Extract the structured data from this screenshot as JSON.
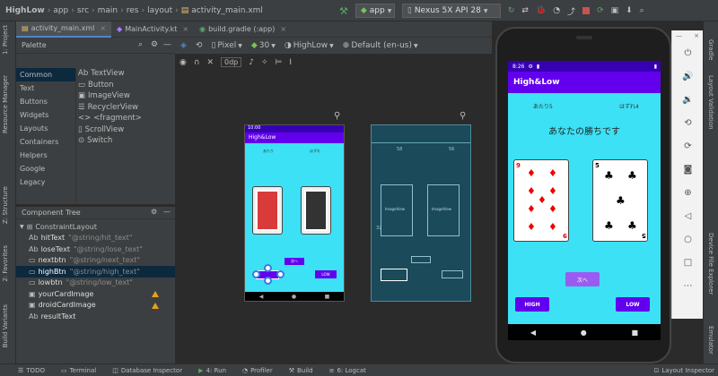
{
  "nav": {
    "crumbs": [
      "HighLow",
      "app",
      "src",
      "main",
      "res",
      "layout",
      "activity_main.xml"
    ],
    "run_config": "app",
    "device": "Nexus 5X API 28"
  },
  "tabs": [
    {
      "label": "activity_main.xml"
    },
    {
      "label": "MainActivity.kt"
    },
    {
      "label": "build.gradle (:app)"
    }
  ],
  "left_strip": [
    "1: Project",
    "Resource Manager",
    "Z: Structure",
    "2: Favorites",
    "Build Variants"
  ],
  "right_strip": [
    "Gradle",
    "Layout Validation",
    "Device File Explorer",
    "Emulator"
  ],
  "palette": {
    "title": "Palette",
    "categories": [
      "Common",
      "Text",
      "Buttons",
      "Widgets",
      "Layouts",
      "Containers",
      "Helpers",
      "Google",
      "Legacy"
    ],
    "items": [
      "TextView",
      "Button",
      "ImageView",
      "RecyclerView",
      "<fragment>",
      "ScrollView",
      "Switch"
    ],
    "item_icons": [
      "Ab",
      "▭",
      "▣",
      "☰",
      "<>",
      "▯",
      "⊙"
    ]
  },
  "tree": {
    "title": "Component Tree",
    "root": "ConstraintLayout",
    "rows": [
      {
        "icon": "Ab",
        "name": "hitText",
        "attr": "\"@string/hit_text\""
      },
      {
        "icon": "Ab",
        "name": "loseText",
        "attr": "\"@string/lose_text\""
      },
      {
        "icon": "▭",
        "name": "nextbtn",
        "attr": "\"@string/next_text\""
      },
      {
        "icon": "▭",
        "name": "highBtn",
        "attr": "\"@string/high_text\""
      },
      {
        "icon": "▭",
        "name": "lowbtn",
        "attr": "\"@string/low_text\""
      },
      {
        "icon": "▣",
        "name": "yourCardImage",
        "attr": ""
      },
      {
        "icon": "▣",
        "name": "droidCardImage",
        "attr": ""
      },
      {
        "icon": "Ab",
        "name": "resultText",
        "attr": ""
      }
    ]
  },
  "designbar": {
    "device": "Pixel",
    "api": "30",
    "theme": "HighLow",
    "locale": "Default (en-us)",
    "margin": "0dp"
  },
  "preview": {
    "time": "10:00",
    "app_title": "High&Low",
    "hit": "あたり",
    "lose": "はずれ",
    "next": "次へ",
    "low": "LOW"
  },
  "blueprint": {
    "image_label": "ImageView",
    "num1": "58",
    "num2": "56",
    "num3": "32"
  },
  "emulator": {
    "time": "8:26",
    "app_title": "High&Low",
    "hit": "あたり5",
    "lose": "はずれ4",
    "result": "あなたの勝ちです",
    "next": "次へ",
    "high": "HIGH",
    "low": "LOW",
    "card_left": "9",
    "card_right": "5"
  },
  "bottom": [
    "TODO",
    "Terminal",
    "Database Inspector",
    "4: Run",
    "Profiler",
    "Build",
    "6: Logcat",
    "Layout Inspector"
  ],
  "colors": {
    "accent": "#6200ee",
    "screen_bg": "#3ce1f5",
    "ide_bg": "#2b2b2b"
  }
}
